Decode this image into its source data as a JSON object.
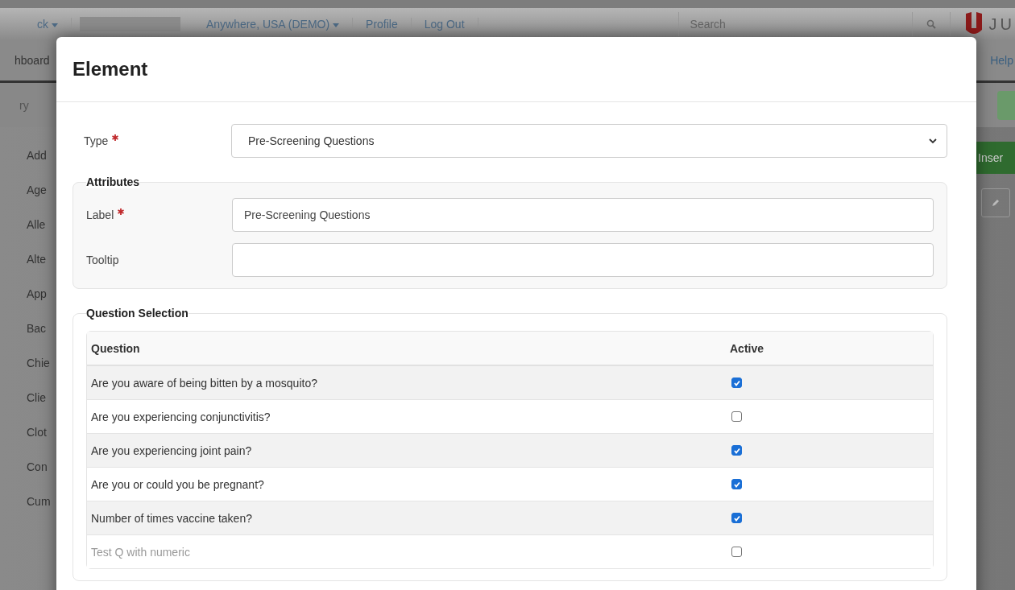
{
  "background": {
    "topbar": {
      "account_menu": "ck",
      "location_menu": "Anywhere, USA (DEMO)",
      "links": [
        "Profile",
        "Log Out"
      ],
      "search": {
        "placeholder": "Search"
      },
      "logo_text": "JU"
    },
    "nav": {
      "left": "hboard",
      "right": "Help"
    },
    "filter": {
      "placeholder": "ry"
    },
    "insert_button": "Inser",
    "sidebar_items": [
      "Add",
      "Age",
      "Alle",
      "Alte",
      "App",
      "Bac",
      "Chie",
      "Clie",
      "Clot",
      "Con",
      "Cum"
    ]
  },
  "modal": {
    "title": "Element",
    "type": {
      "label": "Type",
      "required": true,
      "value": "Pre-Screening Questions"
    },
    "attributes": {
      "legend": "Attributes",
      "fields": [
        {
          "label": "Label",
          "required": true,
          "value": "Pre-Screening Questions"
        },
        {
          "label": "Tooltip",
          "required": false
        }
      ]
    },
    "question_selection": {
      "legend": "Question Selection",
      "columns": [
        "Question",
        "Active"
      ],
      "rows": [
        {
          "question": "Are you aware of being bitten by a mosquito?",
          "active": true,
          "disabled": false
        },
        {
          "question": "Are you experiencing conjunctivitis?",
          "active": false,
          "disabled": false
        },
        {
          "question": "Are you experiencing joint pain?",
          "active": true,
          "disabled": false
        },
        {
          "question": "Are you or could you be pregnant?",
          "active": true,
          "disabled": false
        },
        {
          "question": "Number of times vaccine taken?",
          "active": true,
          "disabled": false
        },
        {
          "question": "Test Q with numeric",
          "active": false,
          "disabled": true
        }
      ]
    }
  }
}
